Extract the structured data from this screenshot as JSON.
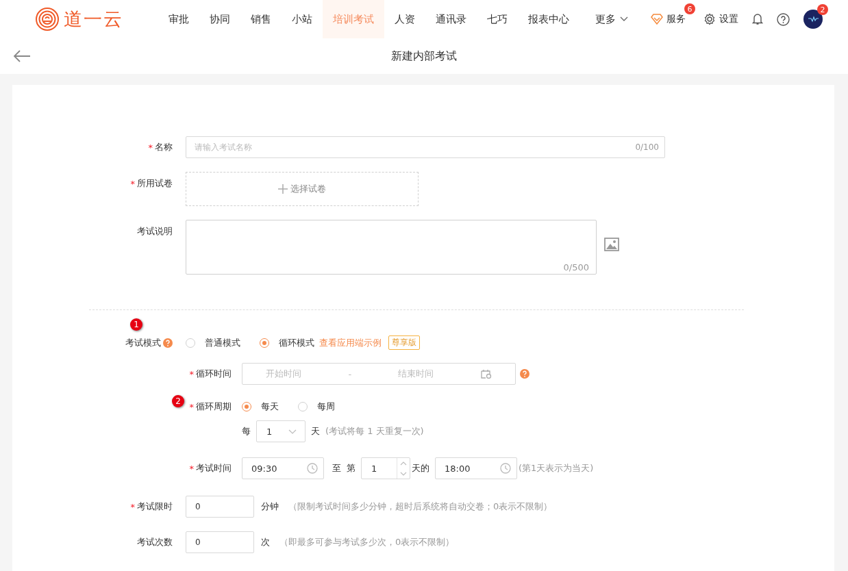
{
  "header": {
    "logo_text": "道一云",
    "nav": [
      {
        "label": "审批",
        "selected": false
      },
      {
        "label": "协同",
        "selected": false
      },
      {
        "label": "销售",
        "selected": false
      },
      {
        "label": "小站",
        "selected": false
      },
      {
        "label": "培训考试",
        "selected": true
      },
      {
        "label": "人资",
        "selected": false
      },
      {
        "label": "通讯录",
        "selected": false
      },
      {
        "label": "七巧",
        "selected": false
      },
      {
        "label": "报表中心",
        "selected": false
      }
    ],
    "more": "更多",
    "service": {
      "label": "服务",
      "badge": "6"
    },
    "settings": "设置",
    "avatar_badge": "2"
  },
  "page_title": "新建内部考试",
  "required_mark": "*",
  "form": {
    "name": {
      "label": "名称",
      "required": true,
      "placeholder": "请输入考试名称",
      "counter": "0/100"
    },
    "paper": {
      "label": "所用试卷",
      "required": true,
      "button": "选择试卷"
    },
    "description": {
      "label": "考试说明",
      "required": false,
      "counter": "0/500"
    },
    "exam_mode": {
      "label": "考试模式",
      "marker": "1",
      "options": [
        {
          "label": "普通模式",
          "selected": false
        },
        {
          "label": "循环模式",
          "selected": true
        }
      ],
      "link": "查看应用端示例",
      "tag": "尊享版"
    },
    "cycle_time": {
      "label": "循环时间",
      "required": true,
      "start_placeholder": "开始时间",
      "separator": "-",
      "end_placeholder": "结束时间"
    },
    "cycle_period": {
      "label": "循环周期",
      "required": true,
      "marker": "2",
      "options": [
        {
          "label": "每天",
          "selected": true
        },
        {
          "label": "每周",
          "selected": false
        }
      ]
    },
    "repeat": {
      "prefix": "每",
      "value": "1",
      "unit": "天",
      "hint": "(考试将每 1 天重复一次)"
    },
    "exam_time": {
      "label": "考试时间",
      "required": true,
      "start": "09:30",
      "to": "至",
      "day_prefix": "第",
      "day": "1",
      "day_suffix": "天的",
      "end": "18:00",
      "hint": "(第1天表示为当天)"
    },
    "time_limit": {
      "label": "考试限时",
      "required": true,
      "value": "0",
      "unit": "分钟",
      "hint": "（限制考试时间多少分钟，超时后系统将自动交卷；0表示不限制）"
    },
    "attempts": {
      "label": "考试次数",
      "required": false,
      "value": "0",
      "unit": "次",
      "hint": "（即最多可参与考试多少次，0表示不限制）"
    }
  }
}
